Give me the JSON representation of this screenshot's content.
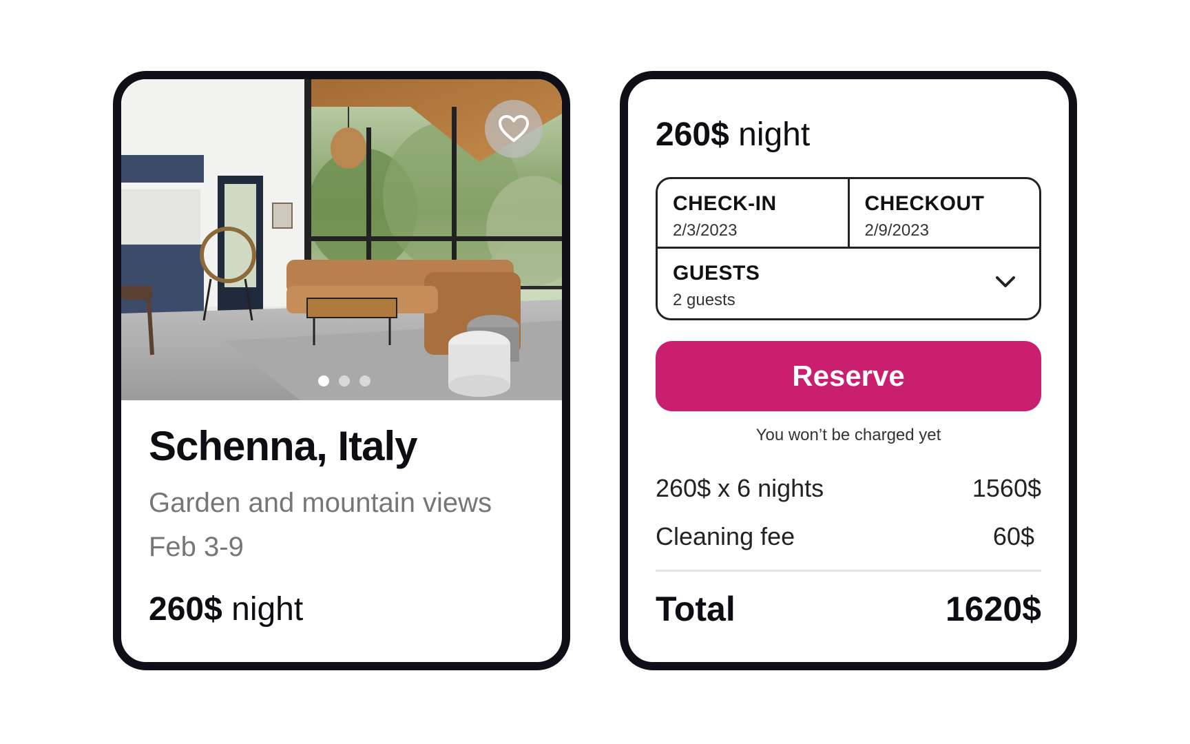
{
  "listing": {
    "photo_alt": "",
    "carousel": {
      "count": 3,
      "active": 1
    },
    "title": "Schenna, Italy",
    "subtitle": "Garden and mountain views",
    "dates": "Feb 3-9",
    "price_amount": "260$",
    "price_unit": "night",
    "favorite_icon": "heart-icon"
  },
  "booking": {
    "price_amount": "260$",
    "price_unit": "night",
    "checkin_label": "CHECK-IN",
    "checkin_value": "2/3/2023",
    "checkout_label": "CHECKOUT",
    "checkout_value": "2/9/2023",
    "guests_label": "GUESTS",
    "guests_value": "2 guests",
    "guests_icon": "chevron-down-icon",
    "reserve_label": "Reserve",
    "note": "You won’t be charged yet",
    "items": [
      {
        "label": "260$ x 6 nights",
        "amount": "1560$"
      },
      {
        "label": "Cleaning fee",
        "amount": "60$"
      }
    ],
    "total_label": "Total",
    "total_amount": "1620$"
  },
  "colors": {
    "accent": "#c91f6e",
    "card_border": "#0f0f17",
    "muted_text": "#767676"
  }
}
